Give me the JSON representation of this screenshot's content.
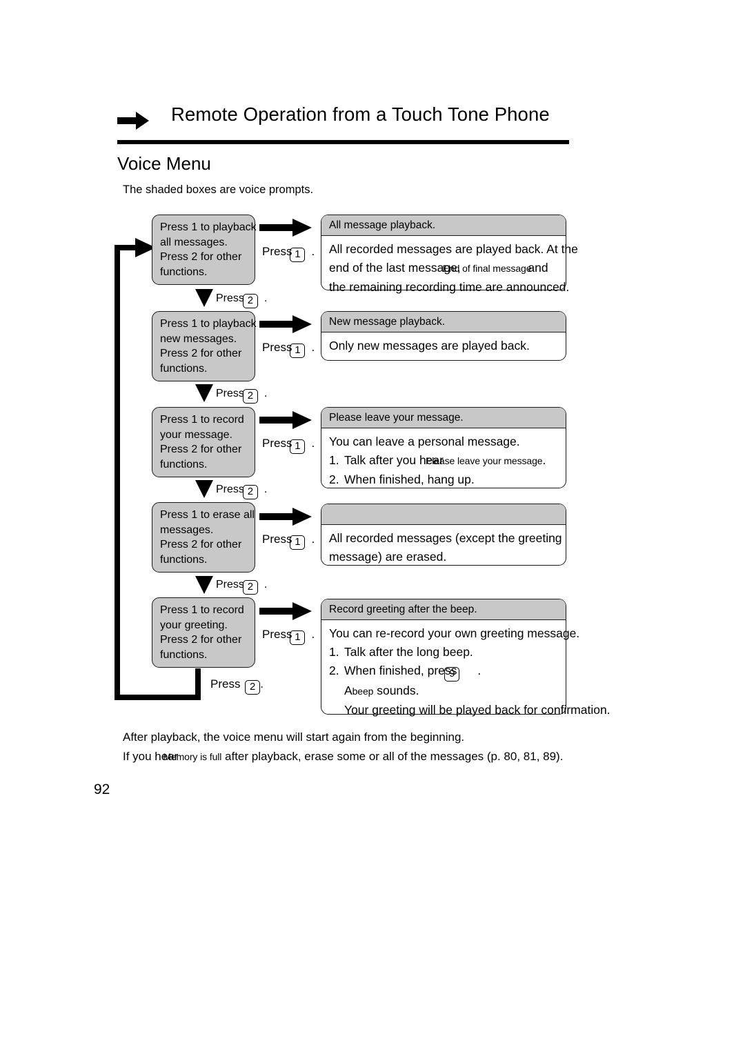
{
  "header": {
    "arrow_icon": "right-arrow-icon",
    "title": "Remote Operation from a Touch Tone Phone"
  },
  "section": {
    "title": "Voice Menu",
    "intro": "The shaded boxes are voice prompts."
  },
  "flow": {
    "press_one_label": "Press",
    "press_two_label": "Press",
    "key_one": "1",
    "key_two": "2",
    "period": ".",
    "rows": [
      {
        "menu": {
          "line1": "Press 1 to playback",
          "line2": "all messages.",
          "line3": "Press 2 for other",
          "line4": "functions."
        },
        "desc": {
          "header": "All message playback.",
          "line1": "All recorded messages are played back. At the",
          "line2a": "end of the last message,",
          "line2_prompt": "End of final message",
          "line2b": "and",
          "line3": "the remaining recording time are announced."
        }
      },
      {
        "menu": {
          "line1": "Press 1 to playback",
          "line2": "new messages.",
          "line3": "Press 2 for other",
          "line4": "functions."
        },
        "desc": {
          "header": "New message playback.",
          "line1": "Only new messages are played back."
        }
      },
      {
        "menu": {
          "line1": "Press 1 to record",
          "line2": "your message.",
          "line3": "Press 2 for other",
          "line4": "functions."
        },
        "desc": {
          "header": "Please leave your message.",
          "line1": "You can leave a personal message.",
          "step1_num": "1.",
          "step1a": "Talk after you hear",
          "step1_prompt": "Please leave your message",
          "step1b": ".",
          "step2_num": "2.",
          "step2": "When finished, hang up."
        }
      },
      {
        "menu": {
          "line1": "Press 1 to erase all",
          "line2": "messages.",
          "line3": "Press 2 for other",
          "line4": "functions."
        },
        "desc": {
          "header": "",
          "line1": "All recorded messages (except the greeting",
          "line2": "message) are erased."
        }
      },
      {
        "menu": {
          "line1": "Press 1 to record",
          "line2": "your greeting.",
          "line3": "Press 2 for other",
          "line4": "functions."
        },
        "desc": {
          "header": "Record greeting after the beep.",
          "line1": "You can re-record your own greeting message.",
          "step1_num": "1.",
          "step1": "Talk after the long beep.",
          "step2_num": "2.",
          "step2a": "When finished, press",
          "step2_key": "9",
          "step2b": ".",
          "step3a": "A",
          "step3_prompt": "beep",
          "step3b": "sounds.",
          "step4": "Your greeting will be played back for confirmation."
        }
      }
    ]
  },
  "footer": {
    "line1": "After playback, the voice menu will start again from the beginning.",
    "line2a": "If you hear",
    "line2_prompt": "Memory is full",
    "line2b": "after playback, erase some or all of the messages (p. 80, 81, 89)."
  },
  "page_number": "92",
  "colors": {
    "shade": "#c8c8c8",
    "ink": "#000000"
  }
}
